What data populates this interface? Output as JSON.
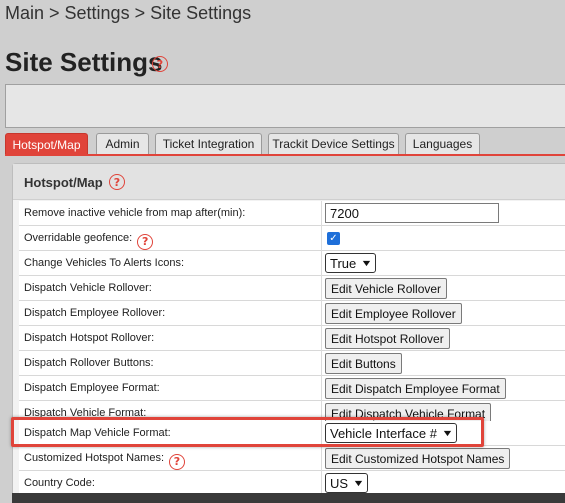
{
  "breadcrumb": "Main > Settings > Site Settings",
  "page_title": "Site Settings",
  "help_glyph": "?",
  "tabs": [
    {
      "label": "Hotspot/Map",
      "active": true
    },
    {
      "label": "Admin",
      "active": false
    },
    {
      "label": "Ticket Integration",
      "active": false
    },
    {
      "label": "Trackit Device Settings",
      "active": false
    },
    {
      "label": "Languages",
      "active": false
    }
  ],
  "panel": {
    "title": "Hotspot/Map",
    "rows": [
      {
        "label": "Remove inactive vehicle from map after(min):",
        "value": "7200"
      },
      {
        "label": "Overridable geofence:",
        "checked": true
      },
      {
        "label": "Change Vehicles To Alerts Icons:",
        "selected": "True"
      },
      {
        "label": "Dispatch Vehicle Rollover:",
        "button": "Edit Vehicle Rollover"
      },
      {
        "label": "Dispatch Employee Rollover:",
        "button": "Edit Employee Rollover"
      },
      {
        "label": "Dispatch Hotspot Rollover:",
        "button": "Edit Hotspot Rollover"
      },
      {
        "label": "Dispatch Rollover Buttons:",
        "button": "Edit Buttons"
      },
      {
        "label": "Dispatch Employee Format:",
        "button": "Edit Dispatch Employee Format"
      },
      {
        "label": "Dispatch Vehicle Format:",
        "button": "Edit Dispatch Vehicle Format"
      },
      {
        "label": "Dispatch Map Vehicle Format:",
        "selected": "Vehicle Interface #"
      },
      {
        "label": "Customized Hotspot Names:",
        "button": "Edit Customized Hotspot Names"
      },
      {
        "label": "Country Code:",
        "selected": "US"
      }
    ]
  },
  "colors": {
    "accent": "#e0443a",
    "checkbox": "#1e6fd9"
  }
}
